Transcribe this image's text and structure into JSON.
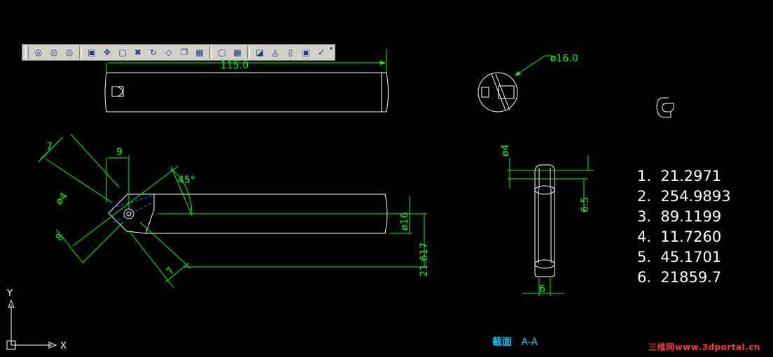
{
  "toolbar": {
    "buttons": [
      {
        "icon": "union-icon",
        "glyph": "◎"
      },
      {
        "icon": "subtract-icon",
        "glyph": "◎"
      },
      {
        "icon": "intersect-icon",
        "glyph": "◎"
      },
      {
        "icon": "extrude-faces-icon",
        "glyph": "▣"
      },
      {
        "icon": "move-faces-icon",
        "glyph": "✥"
      },
      {
        "icon": "offset-faces-icon",
        "glyph": "▢"
      },
      {
        "icon": "delete-faces-icon",
        "glyph": "✖"
      },
      {
        "icon": "rotate-faces-icon",
        "glyph": "↻"
      },
      {
        "icon": "taper-faces-icon",
        "glyph": "◇"
      },
      {
        "icon": "copy-faces-icon",
        "glyph": "❐"
      },
      {
        "icon": "color-faces-icon",
        "glyph": "▦"
      },
      {
        "icon": "copy-edges-icon",
        "glyph": "▢"
      },
      {
        "icon": "color-edges-icon",
        "glyph": "▦"
      },
      {
        "icon": "imprint-icon",
        "glyph": "◪"
      },
      {
        "icon": "clean-icon",
        "glyph": "◬"
      },
      {
        "icon": "separate-icon",
        "glyph": "▯"
      },
      {
        "icon": "shell-icon",
        "glyph": "▣"
      },
      {
        "icon": "check-icon",
        "glyph": "✓"
      }
    ]
  },
  "dimensions": {
    "length": "115.0",
    "diameter_top": "ø16.0",
    "dim_7_top": "7",
    "dim_9": "9",
    "angle": "45°",
    "dia_4_left": "ø4",
    "dim_8": "8",
    "dim_7_bottom": "7",
    "dia_16": "ø16",
    "dim_21617": "21.617",
    "dia_4_right": "ø4",
    "dim_6_5": "6.5",
    "dim_6": "6"
  },
  "results": [
    "1.  21.2971",
    "2.  254.9893",
    "3.  89.1199",
    "4.  11.7260",
    "5.  45.1701",
    "6.  21859.7"
  ],
  "section": {
    "label": "截面",
    "name": "A-A"
  },
  "ucs": {
    "x": "X",
    "y": "Y"
  },
  "watermark": "三维网www.3dportal.cn",
  "colors": {
    "background": "#000000",
    "geometry": "#ffffff",
    "dimension": "#00ff00",
    "label": "#00c8ff",
    "watermark": "#ff3b3b"
  }
}
